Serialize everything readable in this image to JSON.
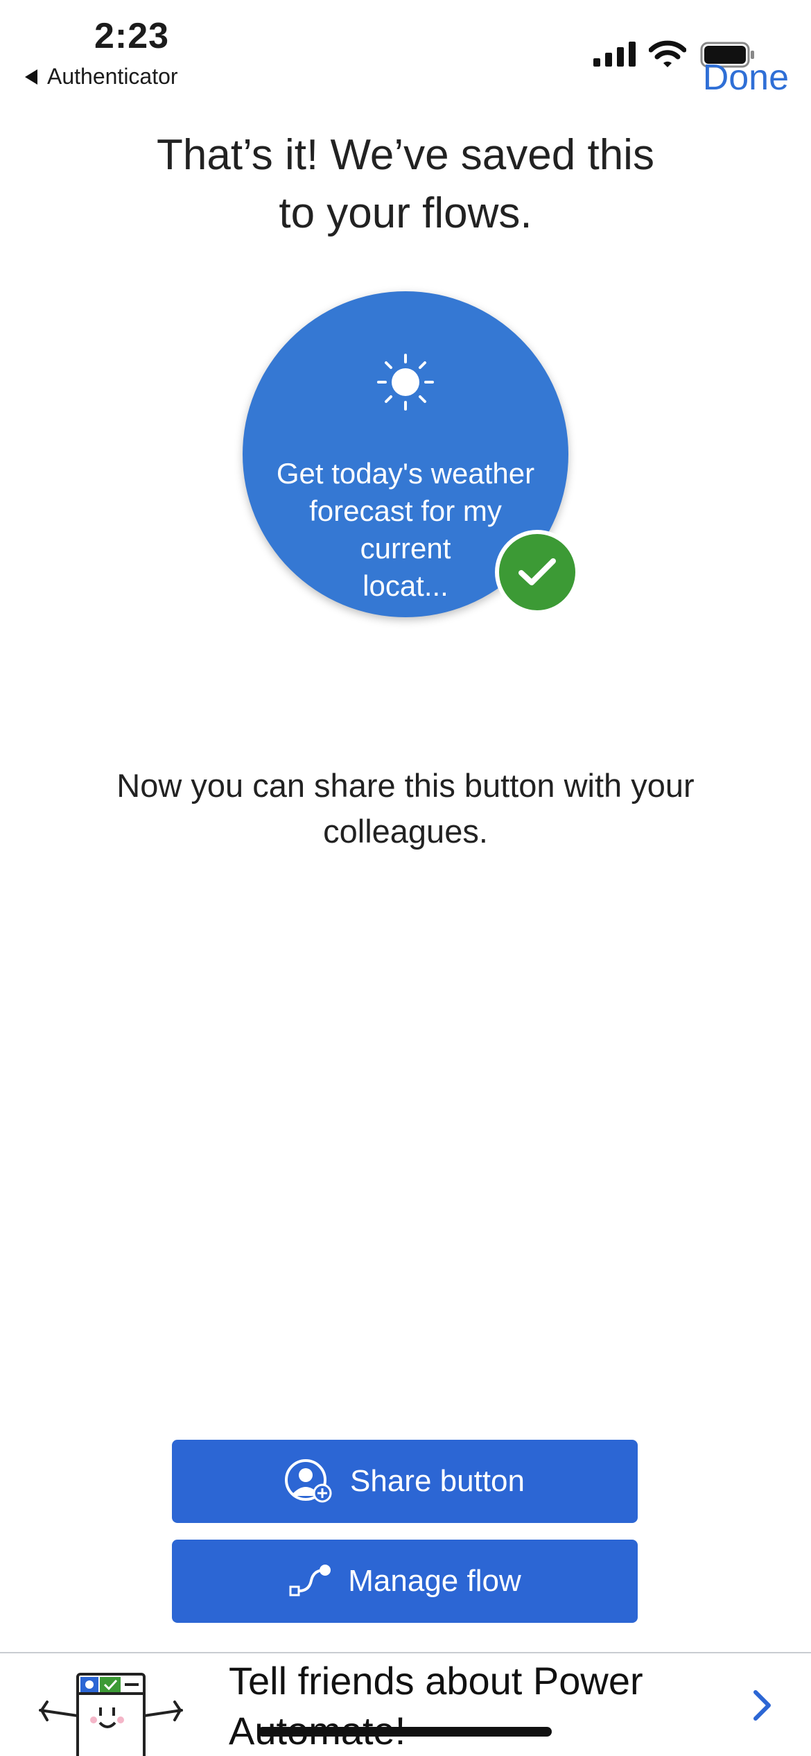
{
  "status_bar": {
    "time": "2:23",
    "back_app_label": "Authenticator",
    "signal_icon": "cellular-signal-icon",
    "wifi_icon": "wifi-icon",
    "battery_icon": "battery-icon"
  },
  "nav": {
    "done_label": "Done"
  },
  "headline": {
    "line1": "That’s it! We’ve saved this",
    "line2": "to your flows."
  },
  "flow_card": {
    "icon": "sun-icon",
    "line1": "Get today's weather",
    "line2": "forecast for my",
    "line3": "current",
    "line4": "locat...",
    "status_icon": "checkmark-icon",
    "colors": {
      "circle": "#3578d3",
      "check": "#3c9a35"
    }
  },
  "message": {
    "line1": "Now you can share this button with your",
    "line2": "colleagues."
  },
  "actions": {
    "share_label": "Share button",
    "share_icon": "add-person-icon",
    "manage_label": "Manage flow",
    "manage_icon": "flow-icon",
    "color": "#2c66d4"
  },
  "banner": {
    "line1": "Tell friends about Power",
    "line2": "Automate!",
    "mascot_icon": "mascot-icon",
    "chevron_icon": "chevron-right-icon"
  }
}
